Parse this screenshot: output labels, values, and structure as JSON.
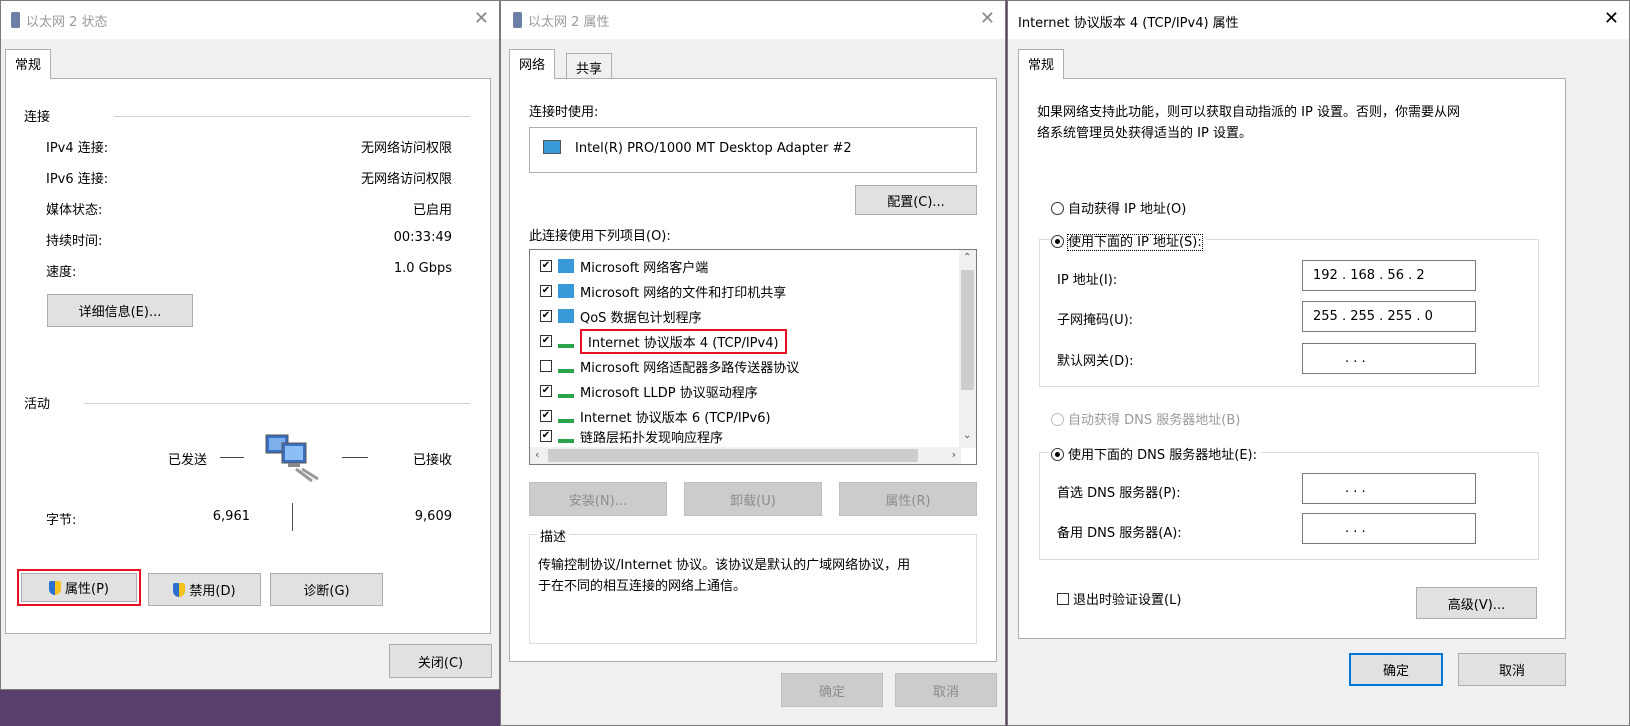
{
  "status_win": {
    "title": "以太网 2 状态",
    "tab": "常规",
    "conn_label": "连接",
    "rows": [
      {
        "label": "IPv4 连接:",
        "value": "无网络访问权限"
      },
      {
        "label": "IPv6 连接:",
        "value": "无网络访问权限"
      },
      {
        "label": "媒体状态:",
        "value": "已启用"
      },
      {
        "label": "持续时间:",
        "value": "00:33:49"
      },
      {
        "label": "速度:",
        "value": "1.0 Gbps"
      }
    ],
    "details_btn": "详细信息(E)...",
    "activity_label": "活动",
    "sent_label": "已发送",
    "recv_label": "已接收",
    "bytes_label": "字节:",
    "bytes_sent": "6,961",
    "bytes_recv": "9,609",
    "props_btn": "属性(P)",
    "disable_btn": "禁用(D)",
    "diagnose_btn": "诊断(G)",
    "close_btn": "关闭(C)"
  },
  "props_win": {
    "title": "以太网 2 属性",
    "tabs": [
      "网络",
      "共享"
    ],
    "connect_using_label": "连接时使用:",
    "adapter": "Intel(R) PRO/1000 MT Desktop Adapter #2",
    "configure_btn": "配置(C)...",
    "items_label": "此连接使用下列项目(O):",
    "items": [
      {
        "label": "Microsoft 网络客户端",
        "checked": "✔"
      },
      {
        "label": "Microsoft 网络的文件和打印机共享",
        "checked": "✔"
      },
      {
        "label": "QoS 数据包计划程序",
        "checked": "✔"
      },
      {
        "label": "Internet 协议版本 4 (TCP/IPv4)",
        "checked": "✔"
      },
      {
        "label": "Microsoft 网络适配器多路传送器协议",
        "checked": ""
      },
      {
        "label": "Microsoft LLDP 协议驱动程序",
        "checked": "✔"
      },
      {
        "label": "Internet 协议版本 6 (TCP/IPv6)",
        "checked": "✔"
      },
      {
        "label": "链路层拓扑发现响应程序",
        "checked": "✔"
      }
    ],
    "install_btn": "安装(N)...",
    "uninstall_btn": "卸载(U)",
    "properties_btn": "属性(R)",
    "desc_label": "描述",
    "desc_line1": "传输控制协议/Internet 协议。该协议是默认的广域网络协议，用",
    "desc_line2": "于在不同的相互连接的网络上通信。",
    "ok_btn": "确定",
    "cancel_btn": "取消"
  },
  "ipv4_win": {
    "title": "Internet 协议版本 4 (TCP/IPv4) 属性",
    "tab": "常规",
    "intro_line1": "如果网络支持此功能，则可以获取自动指派的 IP 设置。否则，你需要从网",
    "intro_line2": "络系统管理员处获得适当的 IP 设置。",
    "auto_ip": "自动获得 IP 地址(O)",
    "manual_ip": "使用下面的 IP 地址(S):",
    "ip_label": "IP 地址(I):",
    "ip_value": "192 . 168 . 56 .  2",
    "mask_label": "子网掩码(U):",
    "mask_value": "255 . 255 . 255 .  0",
    "gw_label": "默认网关(D):",
    "gw_value": ".      .      .",
    "auto_dns": "自动获得 DNS 服务器地址(B)",
    "manual_dns": "使用下面的 DNS 服务器地址(E):",
    "dns1_label": "首选 DNS 服务器(P):",
    "dns1_value": ".      .      .",
    "dns2_label": "备用 DNS 服务器(A):",
    "dns2_value": ".      .      .",
    "validate_label": "退出时验证设置(L)",
    "advanced_btn": "高级(V)...",
    "ok_btn": "确定",
    "cancel_btn": "取消"
  },
  "colors": {
    "highlight": "#e81123",
    "focus": "#0078d7"
  }
}
